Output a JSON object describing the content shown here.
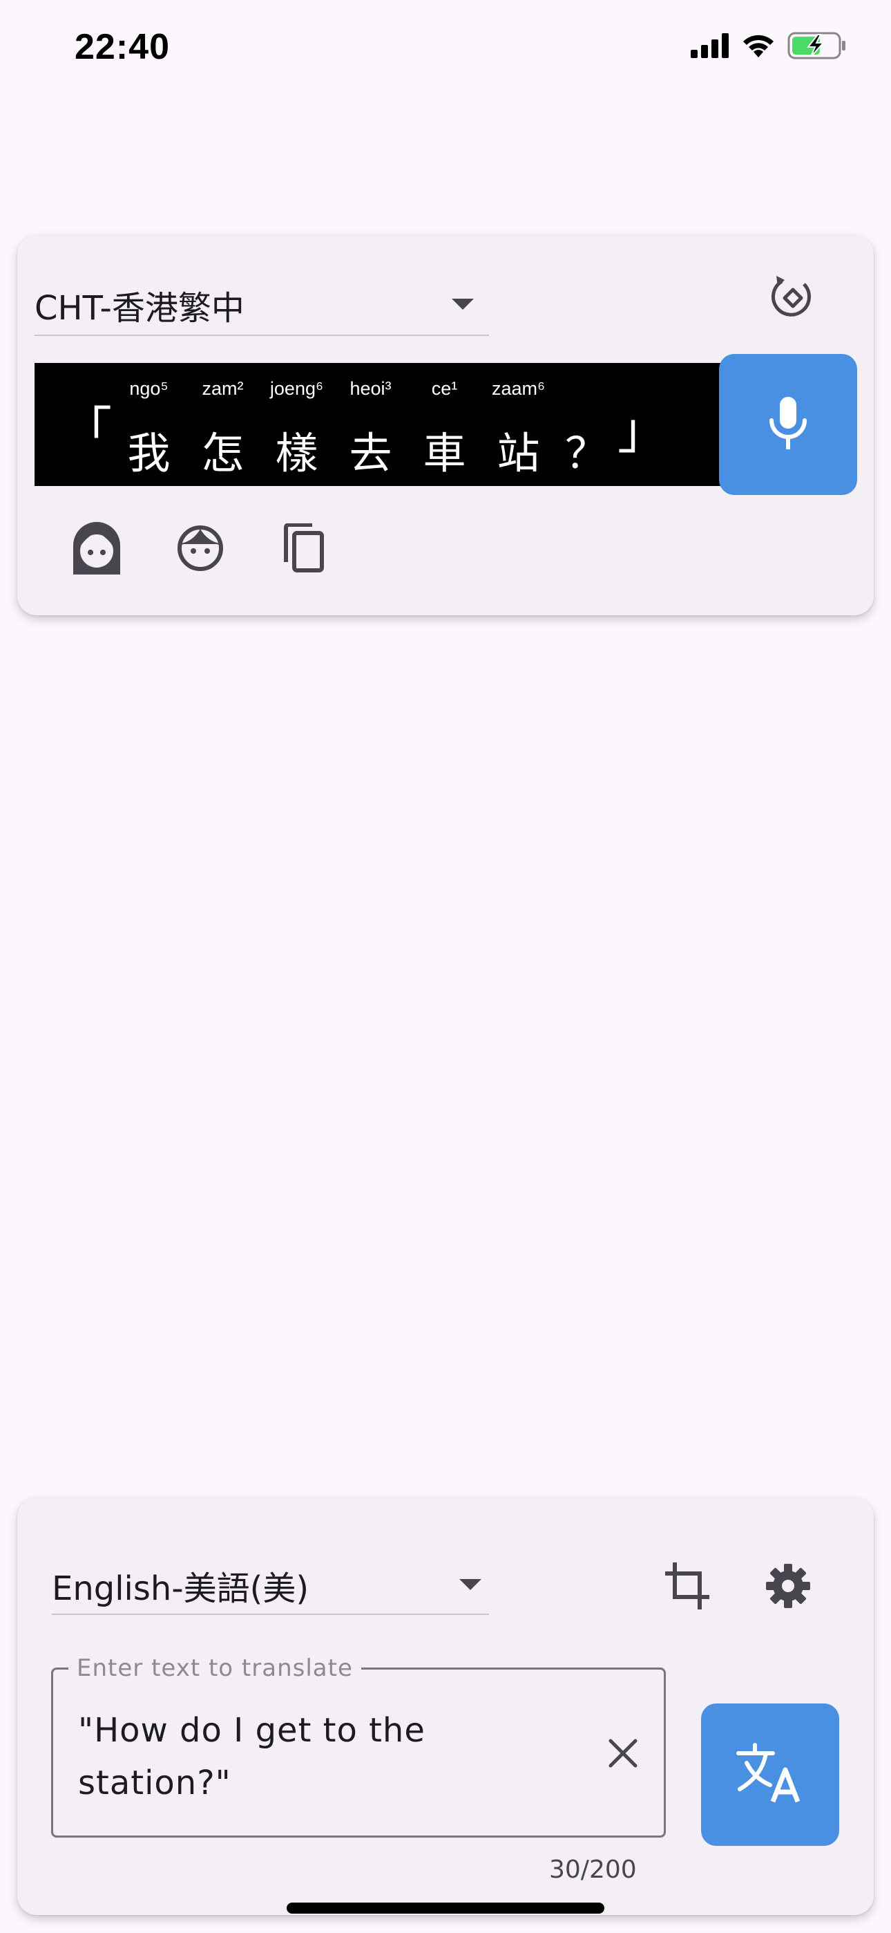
{
  "status_bar": {
    "time": "22:40",
    "icons": [
      "cellular-signal-icon",
      "wifi-icon",
      "battery-charging-icon"
    ]
  },
  "top_card": {
    "language": "CHT-香港繁中",
    "output": {
      "open_bracket": "「",
      "close_bracket": "」",
      "characters": [
        {
          "han": "我",
          "romanization": "ngo⁵"
        },
        {
          "han": "怎",
          "romanization": "zam²"
        },
        {
          "han": "樣",
          "romanization": "joeng⁶"
        },
        {
          "han": "去",
          "romanization": "heoi³"
        },
        {
          "han": "車",
          "romanization": "ce¹"
        },
        {
          "han": "站",
          "romanization": "zaam⁶"
        },
        {
          "han": "？",
          "romanization": ""
        }
      ]
    },
    "icons": [
      "rotate-icon",
      "microphone-icon",
      "female-voice-icon",
      "child-voice-icon",
      "copy-icon"
    ]
  },
  "bottom_card": {
    "language": "English-美語(美)",
    "input": {
      "label": "Enter text to translate",
      "value": "\"How do I get to the station?\""
    },
    "counter": "30/200",
    "icons": [
      "crop-icon",
      "settings-icon",
      "clear-icon",
      "translate-icon"
    ]
  },
  "colors": {
    "accent": "#4a90e2",
    "background": "#fbf7fd",
    "card": "#f3eff5",
    "battery": "#4cd964"
  }
}
